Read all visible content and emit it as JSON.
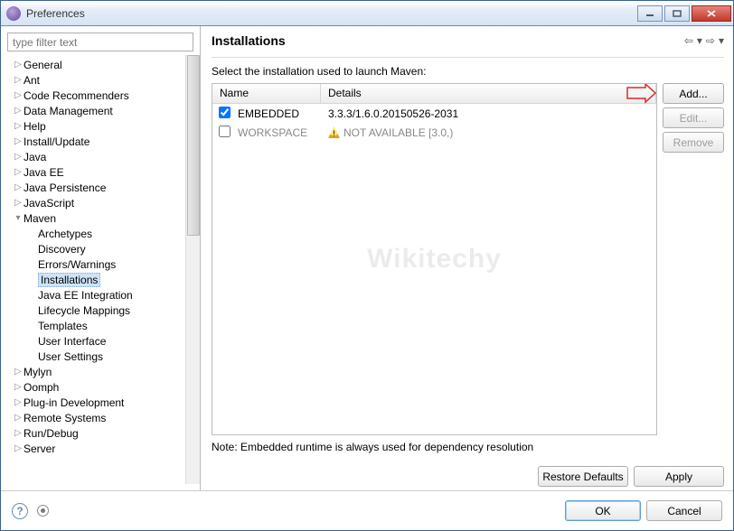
{
  "window": {
    "title": "Preferences"
  },
  "filter": {
    "placeholder": "type filter text"
  },
  "tree": {
    "items": [
      {
        "label": "General",
        "expand": "▷",
        "indent": 0
      },
      {
        "label": "Ant",
        "expand": "▷",
        "indent": 0
      },
      {
        "label": "Code Recommenders",
        "expand": "▷",
        "indent": 0
      },
      {
        "label": "Data Management",
        "expand": "▷",
        "indent": 0
      },
      {
        "label": "Help",
        "expand": "▷",
        "indent": 0
      },
      {
        "label": "Install/Update",
        "expand": "▷",
        "indent": 0
      },
      {
        "label": "Java",
        "expand": "▷",
        "indent": 0
      },
      {
        "label": "Java EE",
        "expand": "▷",
        "indent": 0
      },
      {
        "label": "Java Persistence",
        "expand": "▷",
        "indent": 0
      },
      {
        "label": "JavaScript",
        "expand": "▷",
        "indent": 0
      },
      {
        "label": "Maven",
        "expand": "▾",
        "indent": 0
      },
      {
        "label": "Archetypes",
        "expand": "",
        "indent": 1
      },
      {
        "label": "Discovery",
        "expand": "",
        "indent": 1
      },
      {
        "label": "Errors/Warnings",
        "expand": "",
        "indent": 1
      },
      {
        "label": "Installations",
        "expand": "",
        "indent": 1,
        "selected": true
      },
      {
        "label": "Java EE Integration",
        "expand": "",
        "indent": 1
      },
      {
        "label": "Lifecycle Mappings",
        "expand": "",
        "indent": 1
      },
      {
        "label": "Templates",
        "expand": "",
        "indent": 1
      },
      {
        "label": "User Interface",
        "expand": "",
        "indent": 1
      },
      {
        "label": "User Settings",
        "expand": "",
        "indent": 1
      },
      {
        "label": "Mylyn",
        "expand": "▷",
        "indent": 0
      },
      {
        "label": "Oomph",
        "expand": "▷",
        "indent": 0
      },
      {
        "label": "Plug-in Development",
        "expand": "▷",
        "indent": 0
      },
      {
        "label": "Remote Systems",
        "expand": "▷",
        "indent": 0
      },
      {
        "label": "Run/Debug",
        "expand": "▷",
        "indent": 0
      },
      {
        "label": "Server",
        "expand": "▷",
        "indent": 0
      }
    ]
  },
  "page": {
    "title": "Installations",
    "desc": "Select the installation used to launch Maven:",
    "columns": {
      "name": "Name",
      "details": "Details"
    },
    "rows": [
      {
        "checked": true,
        "name": "EMBEDDED",
        "details": "3.3.3/1.6.0.20150526-2031",
        "warn": false,
        "disabled": false
      },
      {
        "checked": false,
        "name": "WORKSPACE",
        "details": "NOT AVAILABLE [3.0,)",
        "warn": true,
        "disabled": true
      }
    ],
    "buttons": {
      "add": "Add...",
      "edit": "Edit...",
      "remove": "Remove"
    },
    "note": "Note: Embedded runtime is always used for dependency resolution",
    "restore": "Restore Defaults",
    "apply": "Apply"
  },
  "footer": {
    "ok": "OK",
    "cancel": "Cancel"
  },
  "watermark": "Wikitechy"
}
